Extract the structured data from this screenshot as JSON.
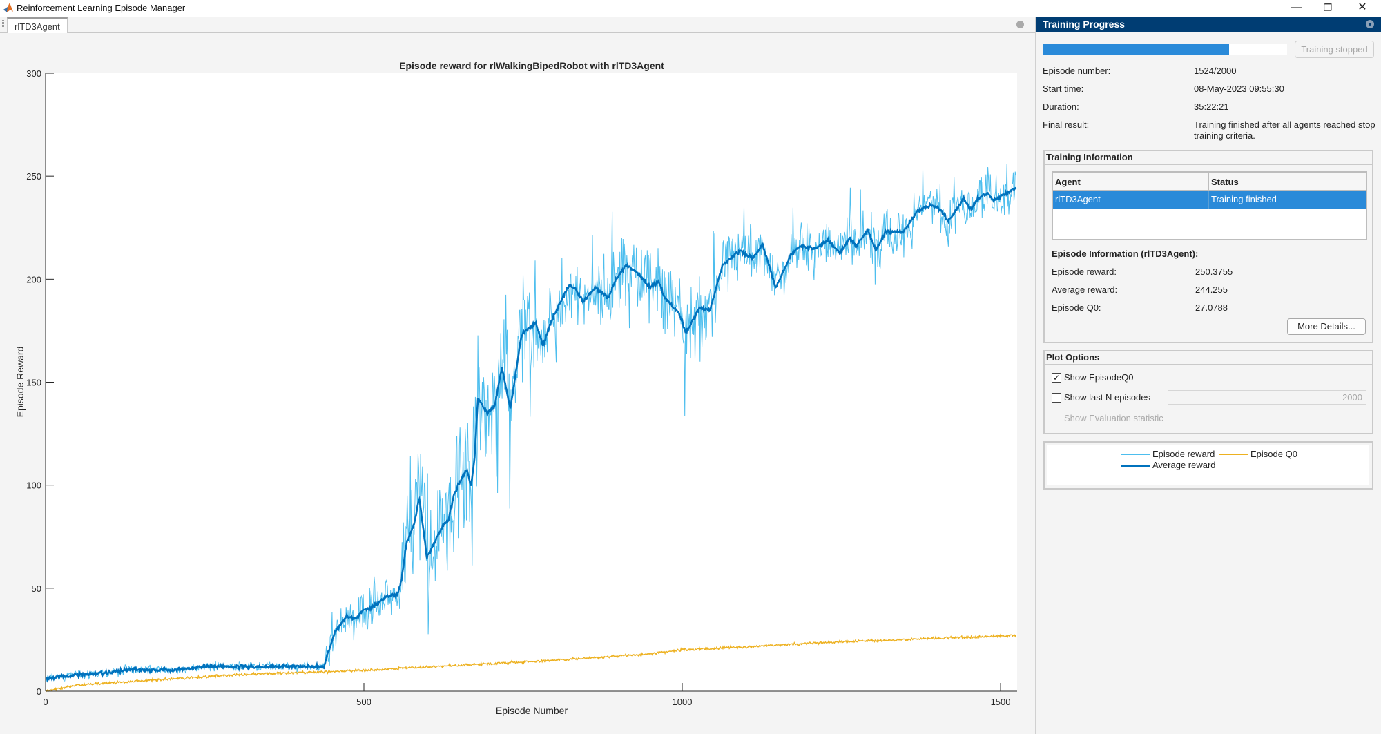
{
  "window": {
    "title": "Reinforcement Learning Episode Manager",
    "minimize": "—",
    "restore": "❐",
    "close": "✕"
  },
  "tabs": [
    {
      "label": "rlTD3Agent"
    }
  ],
  "right_panel": {
    "title": "Training Progress",
    "progress_fraction": 0.762,
    "stop_button": "Training stopped",
    "fields": [
      {
        "label": "Episode number:",
        "value": "1524/2000"
      },
      {
        "label": "Start time:",
        "value": "08-May-2023 09:55:30"
      },
      {
        "label": "Duration:",
        "value": "35:22:21"
      },
      {
        "label": "Final result:",
        "value": "Training finished after all agents reached stop",
        "value2": "training criteria."
      }
    ],
    "training_info": {
      "title": "Training Information",
      "columns": [
        "Agent",
        "Status"
      ],
      "rows": [
        {
          "agent": "rlTD3Agent",
          "status": "Training finished"
        }
      ],
      "episode_info_title": "Episode Information (rlTD3Agent):",
      "episode_fields": [
        {
          "label": "Episode reward:",
          "value": "250.3755"
        },
        {
          "label": "Average reward:",
          "value": "244.255"
        },
        {
          "label": "Episode Q0:",
          "value": "27.0788"
        }
      ],
      "more_details": "More Details..."
    },
    "plot_options": {
      "title": "Plot Options",
      "show_q0": {
        "label": "Show EpisodeQ0",
        "checked": true,
        "mark": "✓"
      },
      "show_last_n": {
        "label": "Show last N episodes",
        "checked": false,
        "value": "2000"
      },
      "show_eval": {
        "label": "Show Evaluation statistic",
        "checked": false,
        "disabled": true
      }
    },
    "legend": [
      "Episode reward",
      "Episode Q0",
      "Average reward"
    ]
  },
  "chart_data": {
    "type": "line",
    "title": "Episode reward for rlWalkingBipedRobot with rlTD3Agent",
    "xlabel": "Episode Number",
    "ylabel": "Episode Reward",
    "xlim": [
      0,
      1526
    ],
    "ylim": [
      0,
      300
    ],
    "xticks": [
      "0",
      "500",
      "1000",
      "1500"
    ],
    "yticks": [
      "0",
      "50",
      "100",
      "150",
      "200",
      "250",
      "300"
    ],
    "grid": false,
    "n_episodes": 1524,
    "colors": {
      "episode_reward": "#4dbeee",
      "average_reward": "#0072bd",
      "episode_q0": "#edb120"
    },
    "series": [
      {
        "name": "Average reward",
        "points": [
          [
            0,
            6
          ],
          [
            50,
            8
          ],
          [
            100,
            9
          ],
          [
            130,
            10.5
          ],
          [
            200,
            10
          ],
          [
            250,
            12
          ],
          [
            437,
            12
          ],
          [
            456,
            30
          ],
          [
            473,
            36
          ],
          [
            489,
            35.5
          ],
          [
            499,
            39.5
          ],
          [
            514,
            41
          ],
          [
            535,
            46
          ],
          [
            553,
            47
          ],
          [
            559,
            54
          ],
          [
            567,
            72
          ],
          [
            578,
            80
          ],
          [
            587,
            93.5
          ],
          [
            599,
            65
          ],
          [
            611,
            72
          ],
          [
            625,
            81
          ],
          [
            633,
            83
          ],
          [
            641,
            95
          ],
          [
            651,
            102
          ],
          [
            662,
            108
          ],
          [
            668,
            99
          ],
          [
            674,
            114
          ],
          [
            679,
            142
          ],
          [
            694,
            135
          ],
          [
            705,
            138
          ],
          [
            717,
            157
          ],
          [
            730,
            137
          ],
          [
            746,
            170
          ],
          [
            750,
            174
          ],
          [
            770,
            179
          ],
          [
            781,
            168
          ],
          [
            795,
            180
          ],
          [
            822,
            197
          ],
          [
            831,
            196
          ],
          [
            844,
            189
          ],
          [
            863,
            196
          ],
          [
            884,
            191
          ],
          [
            896,
            200
          ],
          [
            912,
            207
          ],
          [
            933,
            202
          ],
          [
            950,
            196
          ],
          [
            963,
            199
          ],
          [
            972,
            191
          ],
          [
            994,
            184
          ],
          [
            1006,
            174
          ],
          [
            1015,
            179
          ],
          [
            1026,
            186
          ],
          [
            1044,
            185
          ],
          [
            1063,
            207
          ],
          [
            1091,
            214
          ],
          [
            1111,
            210
          ],
          [
            1126,
            217
          ],
          [
            1147,
            196
          ],
          [
            1171,
            212
          ],
          [
            1185,
            216
          ],
          [
            1210,
            215
          ],
          [
            1229,
            219
          ],
          [
            1248,
            213
          ],
          [
            1263,
            220
          ],
          [
            1274,
            216
          ],
          [
            1291,
            224
          ],
          [
            1304,
            214
          ],
          [
            1319,
            223
          ],
          [
            1348,
            223
          ],
          [
            1369,
            233
          ],
          [
            1391,
            236
          ],
          [
            1405,
            234
          ],
          [
            1418,
            228
          ],
          [
            1442,
            239
          ],
          [
            1453,
            234
          ],
          [
            1464,
            239
          ],
          [
            1480,
            242
          ],
          [
            1489,
            238
          ],
          [
            1505,
            241
          ],
          [
            1524,
            244.255
          ]
        ]
      },
      {
        "name": "Episode reward",
        "spread_by_range": [
          [
            0,
            440,
            1.5
          ],
          [
            440,
            560,
            7
          ],
          [
            560,
            770,
            22
          ],
          [
            770,
            1060,
            12
          ],
          [
            1060,
            1524,
            9
          ]
        ],
        "last": 250.3755
      },
      {
        "name": "Episode Q0",
        "points": [
          [
            0,
            0
          ],
          [
            50,
            3
          ],
          [
            150,
            5
          ],
          [
            300,
            8
          ],
          [
            450,
            9.5
          ],
          [
            550,
            11
          ],
          [
            800,
            15
          ],
          [
            944,
            18
          ],
          [
            1000,
            20
          ],
          [
            1250,
            24
          ],
          [
            1524,
            27.0788
          ]
        ]
      }
    ]
  }
}
